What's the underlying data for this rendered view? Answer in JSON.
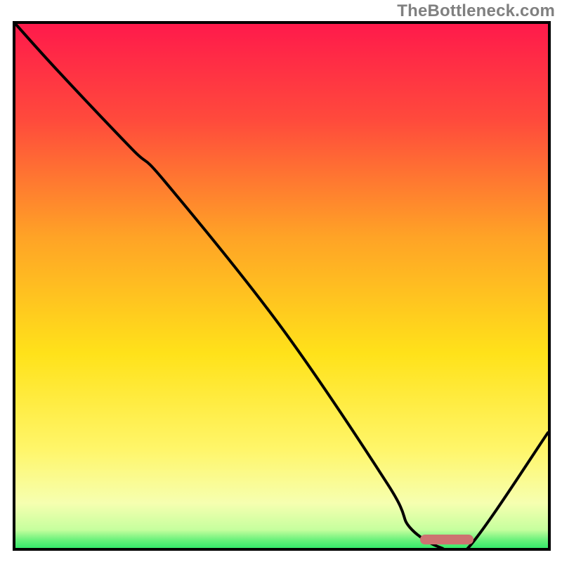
{
  "watermark": "TheBottleneck.com",
  "colors": {
    "top": "#ff1a4b",
    "upper": "#ff7a33",
    "mid": "#ffd21a",
    "lower": "#fff66a",
    "pale": "#f2ffb8",
    "green": "#00e05a",
    "curve": "#000000",
    "marker": "#cd7371",
    "border": "#000000"
  },
  "gradient_stops": [
    {
      "pct": 0,
      "color": "#ff1a4b"
    },
    {
      "pct": 18,
      "color": "#ff4a3c"
    },
    {
      "pct": 40,
      "color": "#ffa326"
    },
    {
      "pct": 62,
      "color": "#ffe21a"
    },
    {
      "pct": 80,
      "color": "#fff66a"
    },
    {
      "pct": 90,
      "color": "#f6ffb0"
    },
    {
      "pct": 95,
      "color": "#c6ff9e"
    },
    {
      "pct": 97,
      "color": "#66f07a"
    },
    {
      "pct": 100,
      "color": "#00e05a"
    }
  ],
  "chart_data": {
    "type": "line",
    "title": "",
    "xlabel": "",
    "ylabel": "",
    "xlim": [
      0,
      100
    ],
    "ylim": [
      0,
      100
    ],
    "series": [
      {
        "name": "bottleneck-curve",
        "x": [
          0,
          8,
          22,
          28,
          50,
          70,
          74,
          80,
          85,
          100
        ],
        "y": [
          100,
          91,
          76,
          70,
          42,
          12,
          4,
          0,
          0,
          22
        ]
      }
    ],
    "annotations": [
      {
        "name": "optimal-range-marker",
        "type": "segment",
        "y": 0.7,
        "x_start": 76,
        "x_end": 86
      }
    ]
  }
}
